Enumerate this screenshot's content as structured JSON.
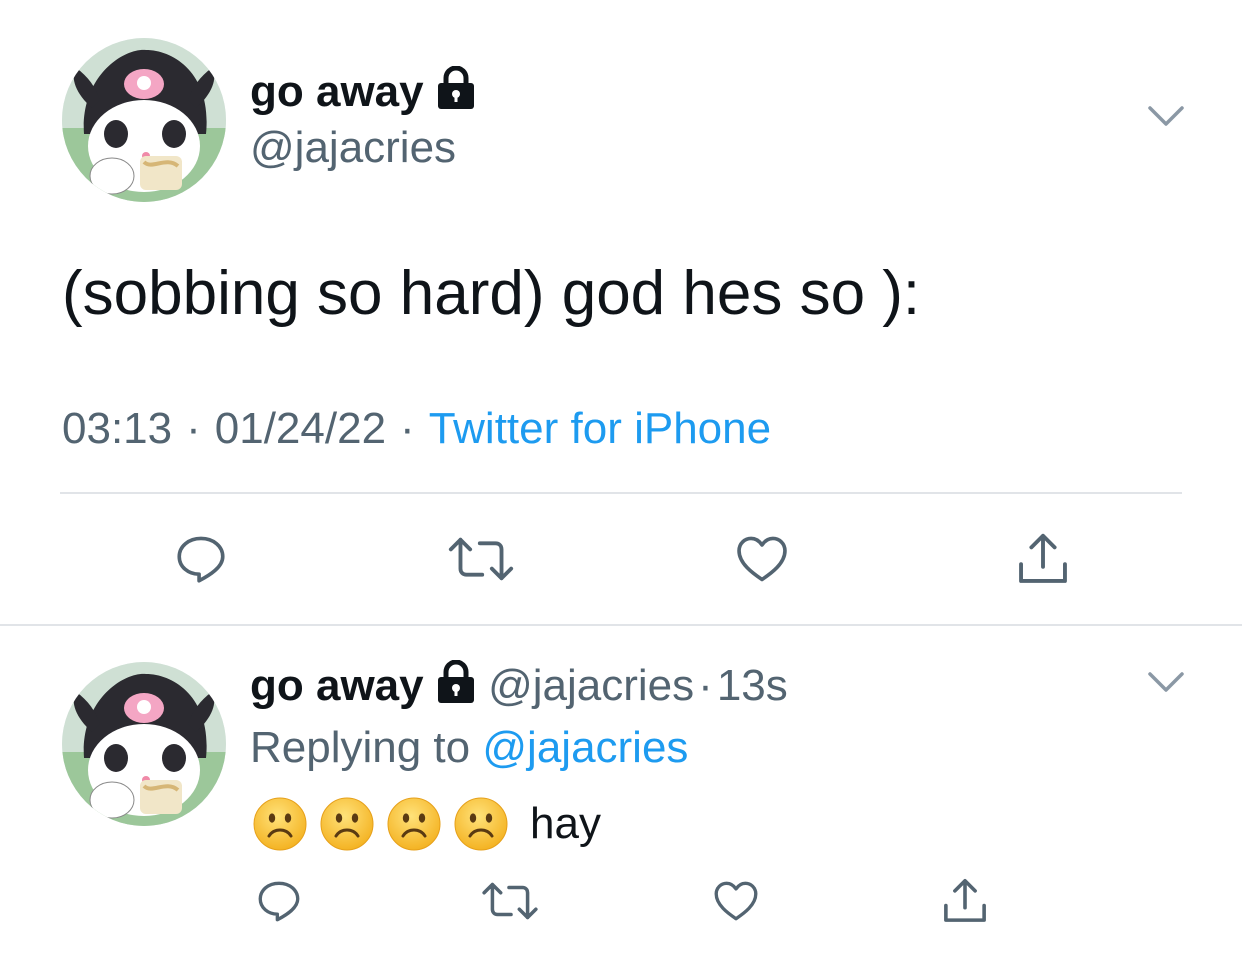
{
  "tweet": {
    "display_name": "go away",
    "handle": "@jajacries",
    "text": "(sobbing so hard) god hes so ):",
    "time": "03:13",
    "date": "01/24/22",
    "source": "Twitter for iPhone",
    "icons": [
      "lock-icon",
      "chevron-down-icon",
      "reply-icon",
      "retweet-icon",
      "like-icon",
      "share-icon"
    ]
  },
  "reply": {
    "display_name": "go away",
    "handle": "@jajacries",
    "age": "13s",
    "replying_prefix": "Replying to",
    "replying_handle": "@jajacries",
    "emoji_count": 4,
    "emoji_name": "frowning-face",
    "text": "hay"
  },
  "colors": {
    "text": "#0f1419",
    "secondary": "#536471",
    "link": "#1d9bf0",
    "icon": "#536471",
    "divider": "#e1e4e8"
  }
}
